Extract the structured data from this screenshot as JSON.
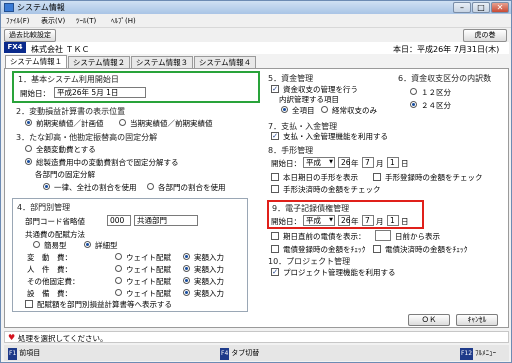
{
  "window": {
    "title": "システム情報"
  },
  "menu": {
    "items": [
      "ﾌｧｲﾙ(F)",
      "表示(V)",
      "ﾂｰﾙ(T)",
      "ﾍﾙﾌﾟ(H)"
    ]
  },
  "toolbar": {
    "past_settings": "過去比較設定",
    "manual": "虎の巻"
  },
  "company": {
    "badge": "FX4",
    "name": "株式会社 ＴＫＣ",
    "date": "本日：平成26年 7月31日(木)"
  },
  "tabs": [
    "システム情報１",
    "システム情報２",
    "システム情報３",
    "システム情報４"
  ],
  "sec1": {
    "title": "1．基本システム利用開始日",
    "start_label": "開始日：",
    "start_value": "平成26年 5月 1日"
  },
  "sec2": {
    "title": "2．変動損益計算書の表示位置",
    "opt1": "前期実績値／計画値",
    "opt2": "当期実績値／前期実績値"
  },
  "sec3": {
    "title": "3．たな卸高・他勘定振替高の固定分解",
    "opt1": "全額変動費とする",
    "opt2": "総製造費用中の変動費割合で固定分解する",
    "sub_label": "各部門の固定分解",
    "sub1": "一律、全社の割合を使用",
    "sub2": "各部門の割合を使用"
  },
  "sec4": {
    "title": "4．部門別管理",
    "code_label": "部門コード省略値",
    "code_value": "000",
    "code_name": "共通部門",
    "alloc_label": "共通費の配賦方法",
    "simple": "簡易型",
    "detail": "詳細型",
    "rows": [
      {
        "name": "変　動　費：",
        "w": "ウェイト配賦",
        "a": "実額入力"
      },
      {
        "name": "人　件　費：",
        "w": "ウェイト配賦",
        "a": "実額入力"
      },
      {
        "name": "その他固定費：",
        "w": "ウェイト配賦",
        "a": "実額入力"
      },
      {
        "name": "設　備　費：",
        "w": "ウェイト配賦",
        "a": "実額入力"
      }
    ],
    "check": "配賦額を部門別損益計算書等へ表示する"
  },
  "sec5": {
    "title": "5．資金管理",
    "check": "資金収支の管理を行う",
    "sub": "内訳管理する項目",
    "opt1": "全項目",
    "opt2": "経常収支のみ"
  },
  "sec6": {
    "title": "6．資金収支区分の内訳数",
    "opt1": "１２区分",
    "opt2": "２４区分"
  },
  "sec7": {
    "title": "7．支払・入金管理",
    "check": "支払・入金管理機能を利用する"
  },
  "sec8": {
    "title": "8．手形管理",
    "start_label": "開始日：",
    "era": "平成",
    "year": "26",
    "month": "7",
    "day": "1",
    "y": "年",
    "m": "月",
    "d": "日",
    "c1": "本日期日の手形を表示",
    "c2": "手形登録時の金額をチェック",
    "c3": "手形決済時の金額をチェック"
  },
  "sec9": {
    "title": "9．電子記録債権管理",
    "start_label": "開始日：",
    "era": "平成",
    "year": "26",
    "month": "7",
    "day": "1",
    "y": "年",
    "m": "月",
    "d": "日",
    "c1": "期日直前の電債を表示：",
    "c1_suffix": "日前から表示",
    "c2": "電債登録時の金額をﾁｪｯｸ",
    "c3": "電債決済時の金額をﾁｪｯｸ"
  },
  "sec10": {
    "title": "10．プロジェクト管理",
    "check": "プロジェクト管理機能を利用する"
  },
  "buttons": {
    "ok": "ＯＫ",
    "cancel": "ｷｬﾝｾﾙ"
  },
  "status": {
    "message": "処理を選択してください。"
  },
  "fkeys": {
    "f1": "前項目",
    "f4": "タブ切替",
    "f12": "ﾌﾙﾒﾆｭｰ"
  }
}
